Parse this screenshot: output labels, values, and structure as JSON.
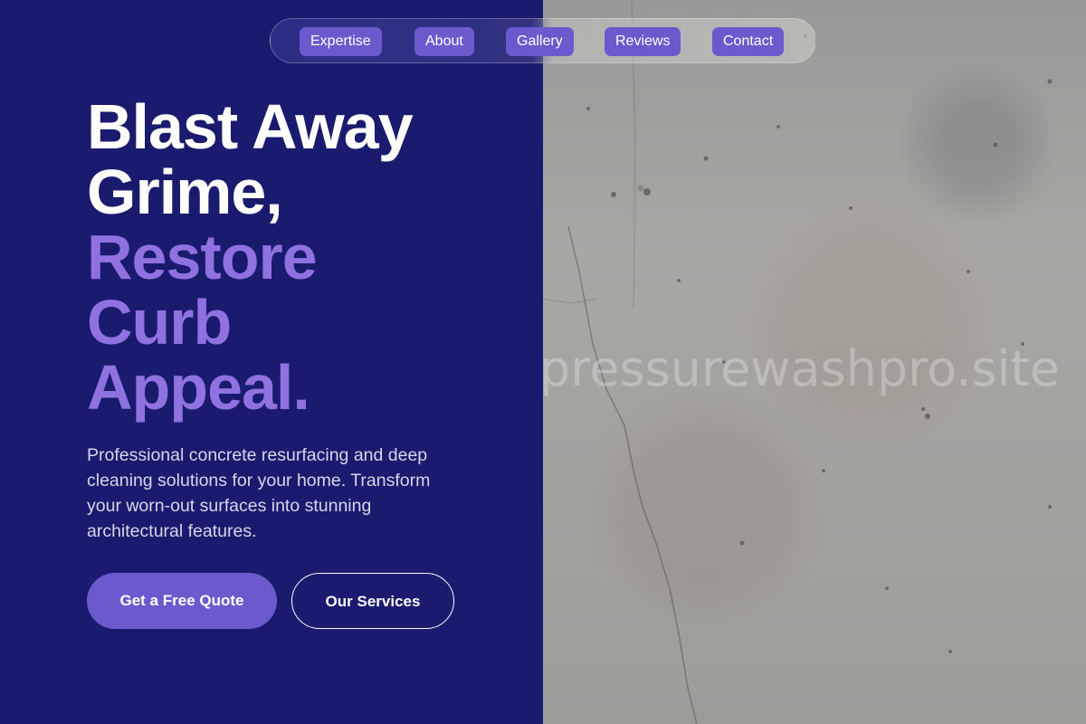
{
  "nav": {
    "items": [
      {
        "label": "Expertise"
      },
      {
        "label": "About"
      },
      {
        "label": "Gallery"
      },
      {
        "label": "Reviews"
      },
      {
        "label": "Contact"
      }
    ]
  },
  "hero": {
    "headline_line1": "Blast Away",
    "headline_line2": "Grime,",
    "headline_line3": "Restore",
    "headline_line4": "Curb",
    "headline_line5": "Appeal.",
    "subtext": "Professional concrete resurfacing and deep cleaning solutions for your home. Transform your worn-out surfaces into stunning architectural features.",
    "primary_cta": "Get a Free Quote",
    "secondary_cta": "Our Services"
  },
  "watermark": "pressurewashpro.site",
  "colors": {
    "panel_bg": "#1a1a6e",
    "accent": "#8f72e0",
    "button": "#6a5acd"
  }
}
